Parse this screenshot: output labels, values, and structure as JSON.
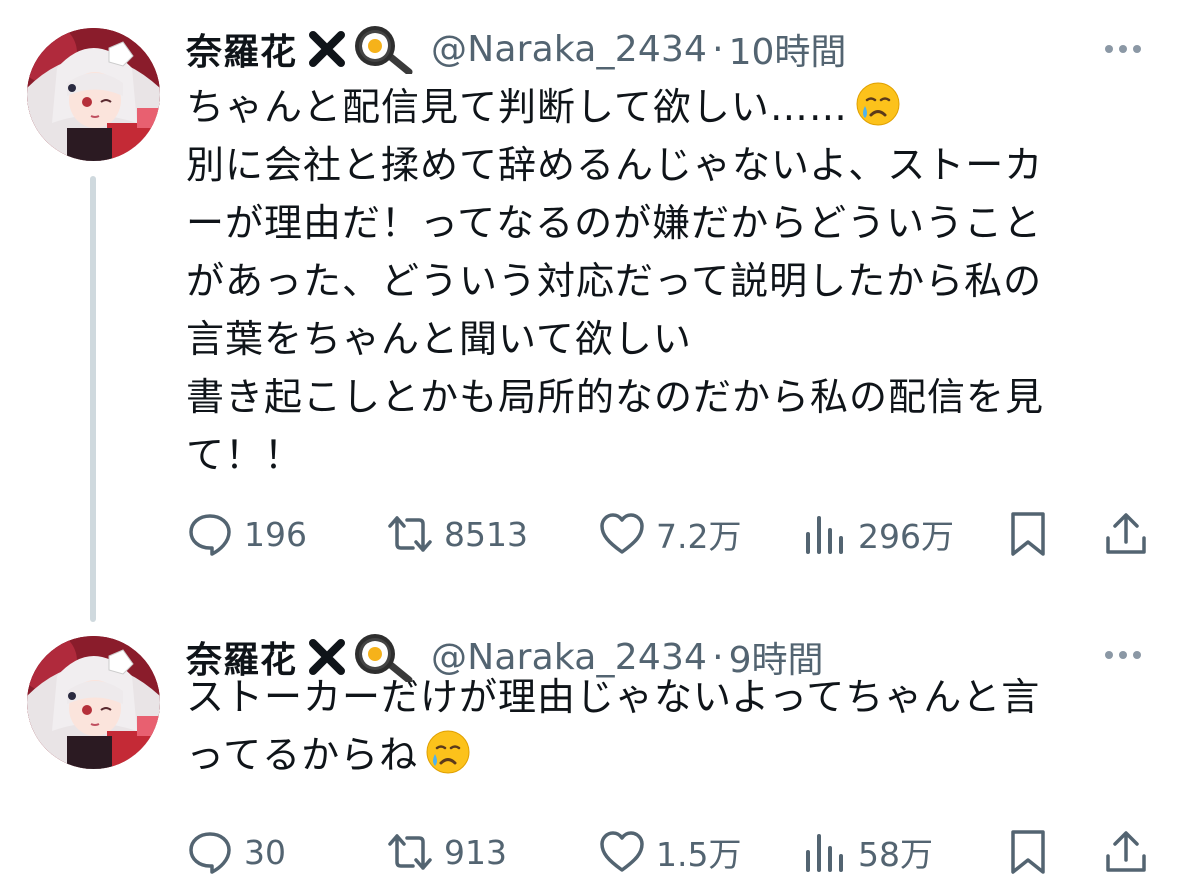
{
  "tweets": [
    {
      "author": {
        "display_name": "奈羅花",
        "badge_icon": "x-mark-icon",
        "emoji_icon": "frying-pan-egg-icon",
        "handle": "@Naraka_2434",
        "separator": "·",
        "time": "10時間"
      },
      "body_lines": [
        "ちゃんと配信見て判断して欲しい……",
        "別に会社と揉めて辞めるんじゃないよ、ストーカ",
        "ーが理由だ！ってなるのが嫌だからどういうこと",
        "があった、どういう対応だって説明したから私の",
        "言葉をちゃんと聞いて欲しい",
        "書き起こしとかも局所的なのだから私の配信を見",
        "て！！"
      ],
      "trailing_emoji_icon": "crying-face-emoji",
      "stats": {
        "replies": "196",
        "retweets": "8513",
        "likes": "7.2万",
        "views": "296万"
      }
    },
    {
      "author": {
        "display_name": "奈羅花",
        "badge_icon": "x-mark-icon",
        "emoji_icon": "frying-pan-egg-icon",
        "handle": "@Naraka_2434",
        "separator": "·",
        "time": "9時間"
      },
      "body_lines": [
        "ストーカーだけが理由じゃないよってちゃんと言",
        "ってるからね"
      ],
      "trailing_emoji_icon": "crying-face-emoji",
      "stats": {
        "replies": "30",
        "retweets": "913",
        "likes": "1.5万",
        "views": "58万"
      }
    }
  ],
  "colors": {
    "text_primary": "#0f1419",
    "text_secondary": "#536471",
    "thread_line": "#cfd9de",
    "background": "#ffffff"
  }
}
